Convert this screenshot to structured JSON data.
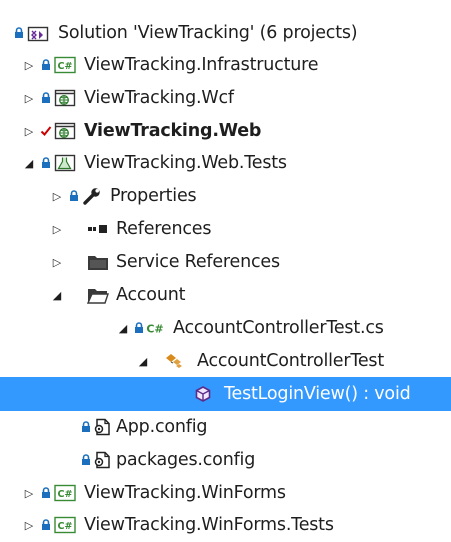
{
  "solution": {
    "label": "Solution 'ViewTracking' (6 projects)"
  },
  "projects": [
    {
      "label": "ViewTracking.Infrastructure",
      "icon": "csharp-project-icon"
    },
    {
      "label": "ViewTracking.Wcf",
      "icon": "web-project-icon"
    },
    {
      "label": "ViewTracking.Web",
      "icon": "web-project-icon"
    },
    {
      "label": "ViewTracking.Web.Tests",
      "icon": "test-project-icon"
    }
  ],
  "web_tests": {
    "properties": "Properties",
    "references": "References",
    "service_references": "Service References",
    "account": "Account",
    "test_file": "AccountControllerTest.cs",
    "test_class": "AccountControllerTest",
    "test_method": "TestLoginView() : void",
    "app_config": "App.config",
    "packages_config": "packages.config"
  },
  "more_projects": [
    {
      "label": "ViewTracking.WinForms",
      "icon": "csharp-project-icon"
    },
    {
      "label": "ViewTracking.WinForms.Tests",
      "icon": "csharp-project-icon"
    }
  ],
  "colors": {
    "selection": "#3399ff",
    "lock": "#1b6fbd",
    "checkmark": "#cc0000",
    "csharp": "#388a34",
    "folder": "#3a3a3a"
  }
}
